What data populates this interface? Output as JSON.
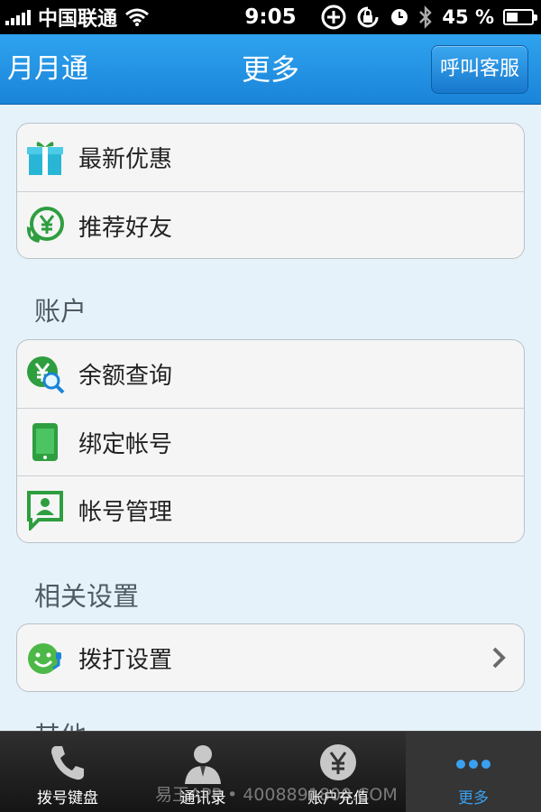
{
  "status_bar": {
    "carrier": "中国联通",
    "time": "9:05",
    "battery_percent": "45 %",
    "battery_level": 0.45
  },
  "nav_bar": {
    "left_title": "月月通",
    "title": "更多",
    "call_service_label": "呼叫客服"
  },
  "groups": [
    {
      "title": "",
      "items": [
        {
          "label": "最新优惠",
          "icon": "gift-icon"
        },
        {
          "label": "推荐好友",
          "icon": "recommend-friend-icon"
        }
      ]
    },
    {
      "title": "账户",
      "items": [
        {
          "label": "余额查询",
          "icon": "balance-query-icon"
        },
        {
          "label": "绑定帐号",
          "icon": "phone-icon"
        },
        {
          "label": "帐号管理",
          "icon": "account-manage-icon"
        }
      ]
    },
    {
      "title": "相关设置",
      "items": [
        {
          "label": "拨打设置",
          "icon": "dial-settings-icon",
          "chevron": true
        }
      ]
    }
  ],
  "next_section_peek": "其他",
  "tab_bar": {
    "tabs": [
      {
        "label": "拨号键盘",
        "icon": "phone-handset-icon"
      },
      {
        "label": "通讯录",
        "icon": "contacts-icon"
      },
      {
        "label": "账户充值",
        "icon": "yen-coin-icon"
      },
      {
        "label": "更多",
        "icon": "more-dots-icon",
        "active": true
      }
    ]
  },
  "watermark": "易玉APP • 4008891800.COM",
  "colors": {
    "nav_blue": "#1a84d9",
    "active_tab": "#3aa0f0",
    "icon_green": "#2e9e3f",
    "background": "#e6f2fa"
  }
}
